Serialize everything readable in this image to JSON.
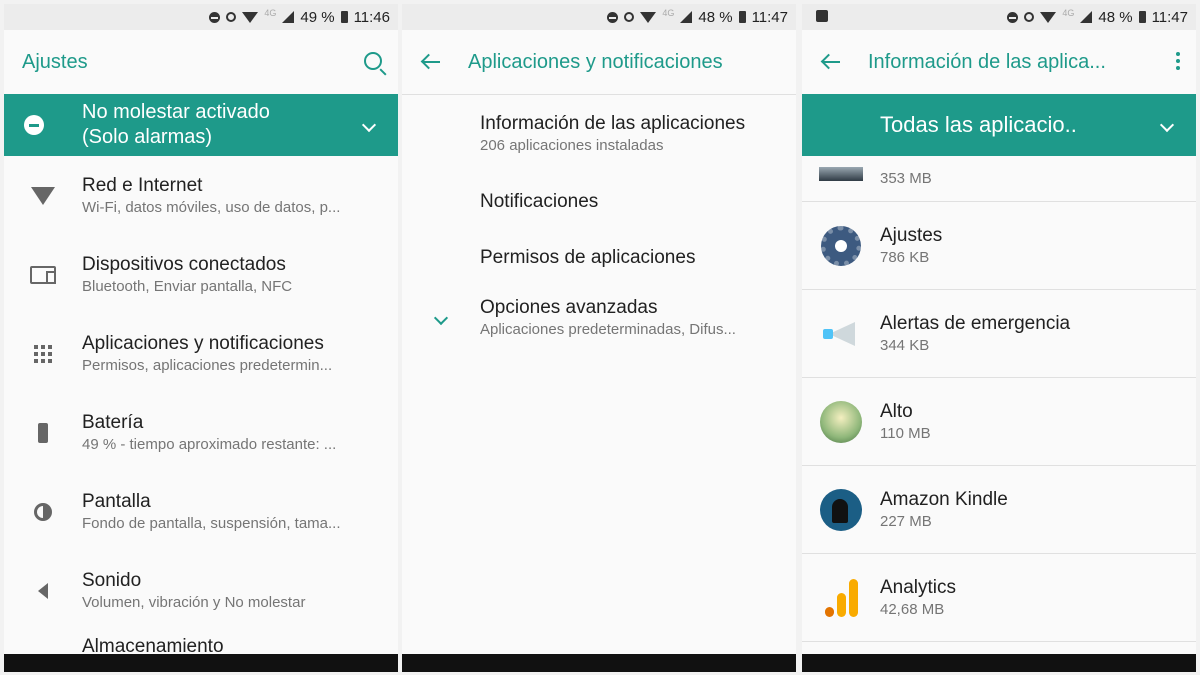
{
  "colors": {
    "accent": "#1e9a8a",
    "analytics_orange": "#f9ab00",
    "analytics_dark": "#e37400"
  },
  "panel1": {
    "status": {
      "battery": "49 %",
      "time": "11:46",
      "network": "4G"
    },
    "title": "Ajustes",
    "dnd": {
      "line1": "No molestar activado",
      "line2": "(Solo alarmas)"
    },
    "items": [
      {
        "icon": "wifi-icon",
        "title": "Red e Internet",
        "subtitle": "Wi-Fi, datos móviles, uso de datos, p..."
      },
      {
        "icon": "devices-icon",
        "title": "Dispositivos conectados",
        "subtitle": "Bluetooth, Enviar pantalla, NFC"
      },
      {
        "icon": "apps-grid-icon",
        "title": "Aplicaciones y notificaciones",
        "subtitle": "Permisos, aplicaciones predetermin..."
      },
      {
        "icon": "battery-icon",
        "title": "Batería",
        "subtitle": "49 % - tiempo aproximado restante: ..."
      },
      {
        "icon": "brightness-icon",
        "title": "Pantalla",
        "subtitle": "Fondo de pantalla, suspensión, tama..."
      },
      {
        "icon": "speaker-icon",
        "title": "Sonido",
        "subtitle": "Volumen, vibración y No molestar"
      }
    ],
    "partial_item": "Almacenamiento"
  },
  "panel2": {
    "status": {
      "battery": "48 %",
      "time": "11:47",
      "network": "4G"
    },
    "title": "Aplicaciones y notificaciones",
    "items": [
      {
        "title": "Información de las aplicaciones",
        "subtitle": "206 aplicaciones instaladas"
      },
      {
        "title": "Notificaciones"
      },
      {
        "title": "Permisos de aplicaciones"
      },
      {
        "title": "Opciones avanzadas",
        "subtitle": "Aplicaciones predeterminadas, Difus..."
      }
    ]
  },
  "panel3": {
    "status": {
      "battery": "48 %",
      "time": "11:47",
      "network": "4G"
    },
    "title": "Información de las aplica...",
    "filter": "Todas las aplicacio..",
    "apps": [
      {
        "name": "",
        "size": "353 MB",
        "icon": "app-image-icon"
      },
      {
        "name": "Ajustes",
        "size": "786 KB",
        "icon": "settings-gear-icon"
      },
      {
        "name": "Alertas de emergencia",
        "size": "344 KB",
        "icon": "megaphone-icon"
      },
      {
        "name": "Alto",
        "size": "110 MB",
        "icon": "alto-game-icon"
      },
      {
        "name": "Amazon Kindle",
        "size": "227 MB",
        "icon": "kindle-icon"
      },
      {
        "name": "Analytics",
        "size": "42,68 MB",
        "icon": "analytics-icon"
      }
    ]
  }
}
